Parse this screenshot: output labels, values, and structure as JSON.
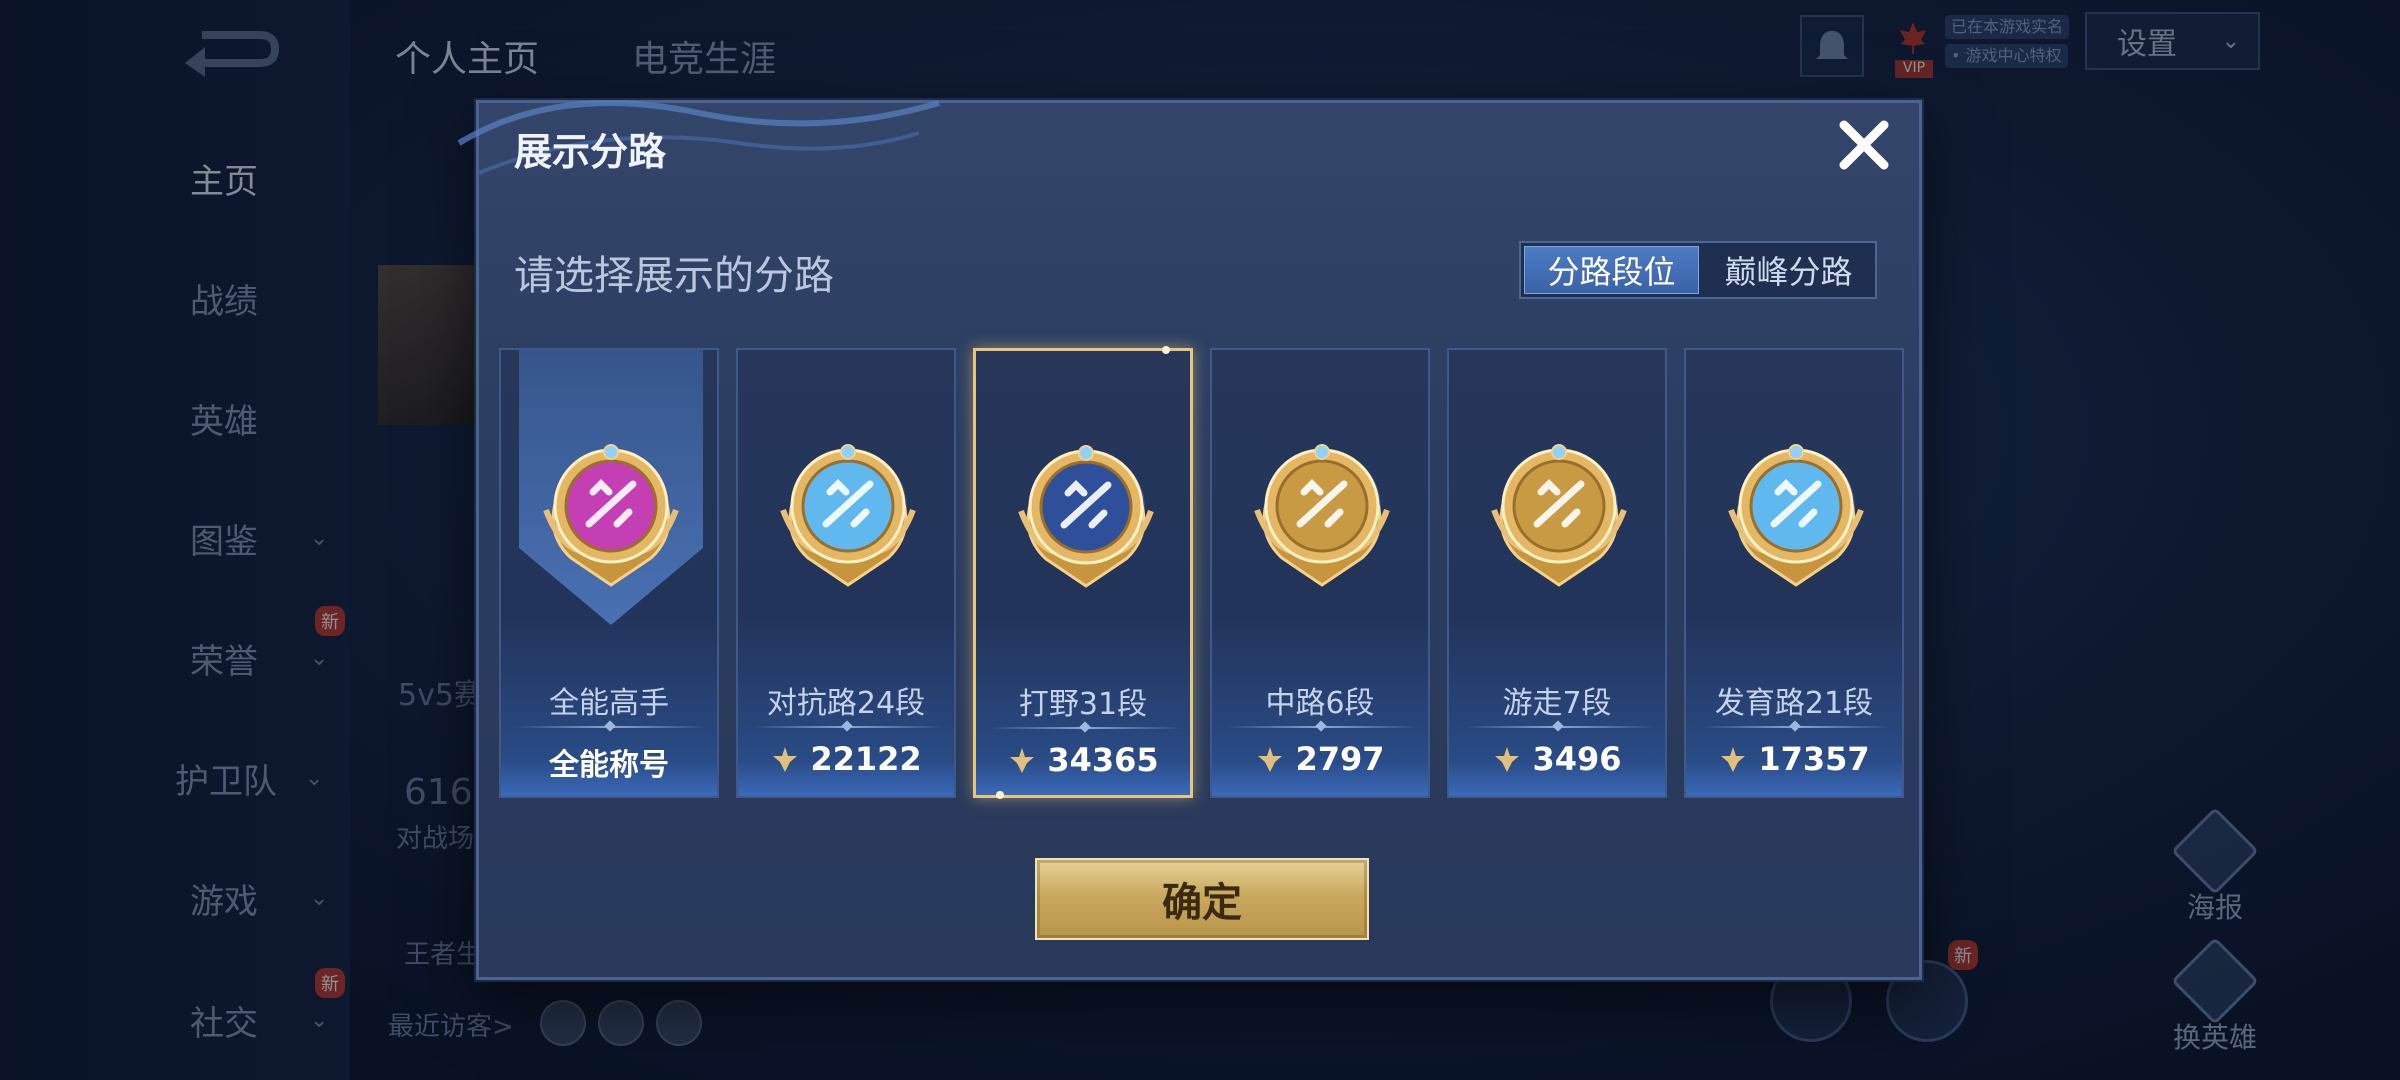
{
  "background": {
    "top_tabs": [
      "个人主页",
      "电竞生涯"
    ],
    "nav": [
      {
        "label": "主页",
        "active": true,
        "has_chevron": false,
        "new": false
      },
      {
        "label": "战绩",
        "active": false,
        "has_chevron": false,
        "new": false
      },
      {
        "label": "英雄",
        "active": false,
        "has_chevron": false,
        "new": false
      },
      {
        "label": "图鉴",
        "active": false,
        "has_chevron": true,
        "new": false
      },
      {
        "label": "荣誉",
        "active": false,
        "has_chevron": true,
        "new": true
      },
      {
        "label": "护卫队",
        "active": false,
        "has_chevron": true,
        "new": false
      },
      {
        "label": "游戏",
        "active": false,
        "has_chevron": true,
        "new": false
      },
      {
        "label": "社交",
        "active": false,
        "has_chevron": true,
        "new": true
      }
    ],
    "new_badge": "新",
    "settings_label": "设置",
    "vip_label": "VIP",
    "tag_1": "已在本游戏实名",
    "tag_2": "• 游戏中心特权",
    "season_text": "5v5赛",
    "stat_number": "616",
    "stat_label": "对战场",
    "king_text": "王者生",
    "recent_visitors": "最近访客>",
    "poster_label": "海报",
    "switch_hero_label": "换英雄"
  },
  "modal": {
    "title": "展示分路",
    "subtitle": "请选择展示的分路",
    "toggle": {
      "options": [
        "分路段位",
        "巅峰分路"
      ],
      "active_index": 0
    },
    "confirm_label": "确定",
    "cards": [
      {
        "name": "全能高手",
        "score": "全能称号",
        "score_is_title": true,
        "emblem_color": "#c33fb3",
        "selected": false,
        "icon": "all-round-emblem-icon"
      },
      {
        "name": "对抗路24段",
        "score": "22122",
        "score_is_title": false,
        "emblem_color": "#5fb9ef",
        "selected": false,
        "icon": "clash-lane-emblem-icon"
      },
      {
        "name": "打野31段",
        "score": "34365",
        "score_is_title": false,
        "emblem_color": "#2f4f9a",
        "selected": true,
        "icon": "jungle-emblem-icon"
      },
      {
        "name": "中路6段",
        "score": "2797",
        "score_is_title": false,
        "emblem_color": "#c89a43",
        "selected": false,
        "icon": "mid-lane-emblem-icon"
      },
      {
        "name": "游走7段",
        "score": "3496",
        "score_is_title": false,
        "emblem_color": "#c89a43",
        "selected": false,
        "icon": "roam-emblem-icon"
      },
      {
        "name": "发育路21段",
        "score": "17357",
        "score_is_title": false,
        "emblem_color": "#5fb9ef",
        "selected": false,
        "icon": "farm-lane-emblem-icon"
      }
    ]
  },
  "colors": {
    "accent_gold": "#e8c57a",
    "toggle_active": "#4e7bc4",
    "modal_bg": "#2b3d5f"
  }
}
